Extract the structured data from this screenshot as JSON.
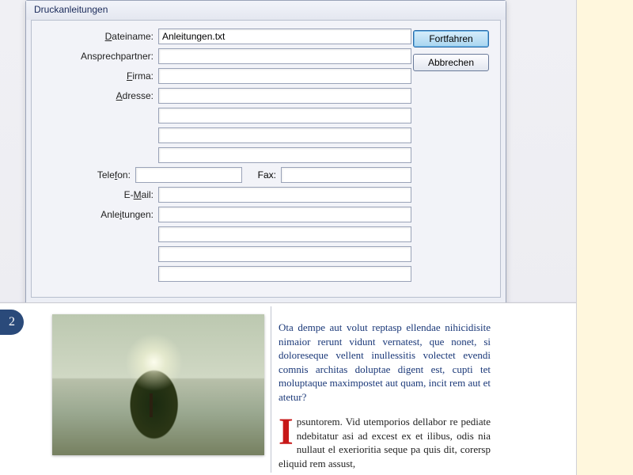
{
  "dialog": {
    "title": "Druckanleitungen",
    "labels": {
      "dateiname_pre": "D",
      "dateiname_post": "ateiname:",
      "ansprechpartner": "Ansprechpartner:",
      "firma_pre": "F",
      "firma_post": "irma:",
      "adresse_pre": "A",
      "adresse_post": "dresse:",
      "telefon_pre": "Tele",
      "telefon_u": "f",
      "telefon_post": "on:",
      "fax_pre": "Fa",
      "fax_u": "x",
      "fax_post": ":",
      "email_pre": "E-",
      "email_u": "M",
      "email_post": "ail:",
      "anleitungen_pre": "Anle",
      "anleitungen_u": "i",
      "anleitungen_post": "tungen:"
    },
    "values": {
      "dateiname": "Anleitungen.txt",
      "ansprechpartner": "",
      "firma": "",
      "adresse1": "",
      "adresse2": "",
      "adresse3": "",
      "adresse4": "",
      "telefon": "",
      "fax": "",
      "email": "",
      "anleitungen1": "",
      "anleitungen2": "",
      "anleitungen3": "",
      "anleitungen4": ""
    },
    "buttons": {
      "continue": "Fortfahren",
      "cancel": "Abbrechen"
    }
  },
  "page": {
    "number": "2",
    "para1": "Ota dempe aut volut reptasp ellendae nihici­disite nimaior rerunt vidunt vernatest, que nonet, si doloreseque vellent inullessitis volec­tet evendi comnis architas doluptae digent est, cupti tet moluptaque maximpostet aut quam, incit rem aut et atetur?",
    "dropcap": "I",
    "para2": "psuntorem. Vid utemporios dellabor re pediate ndebitatur asi ad excest ex et ili­bus, odis nia nullaut el exerioritia seque pa quis dit, corersp eliquid rem assust,"
  }
}
